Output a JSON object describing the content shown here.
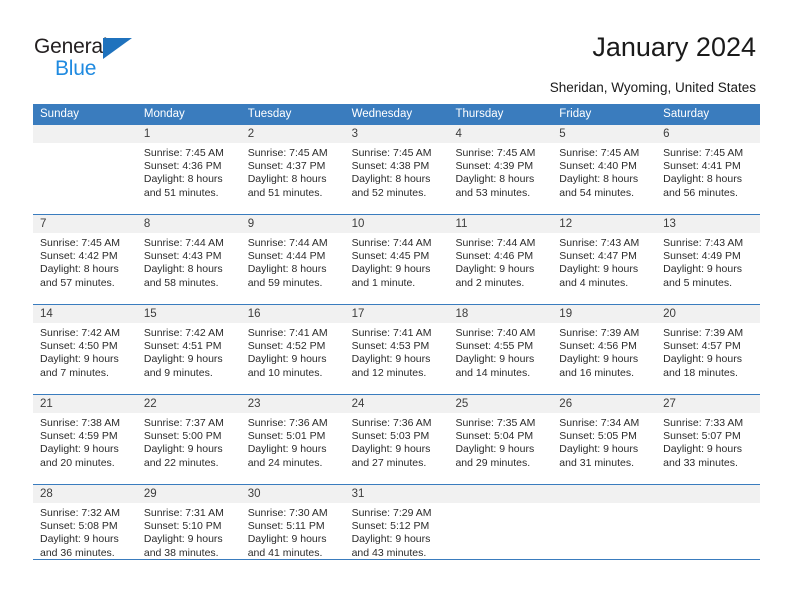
{
  "brand": {
    "name_part1": "General",
    "name_part2": "Blue",
    "triangle_icon": "triangle-icon",
    "color_dark": "#231f20",
    "color_blue": "#1f8ae0",
    "color_triangle": "#1f72bd"
  },
  "header": {
    "title": "January 2024",
    "subtitle": "Sheridan, Wyoming, United States"
  },
  "theme": {
    "header_blue": "#3a7cbe",
    "daynum_band": "#f1f1f1",
    "text": "#2b2b2b"
  },
  "weekday_headers": [
    "Sunday",
    "Monday",
    "Tuesday",
    "Wednesday",
    "Thursday",
    "Friday",
    "Saturday"
  ],
  "weeks": [
    [
      {
        "day": "",
        "lines": [
          "",
          "",
          "",
          ""
        ]
      },
      {
        "day": "1",
        "lines": [
          "Sunrise: 7:45 AM",
          "Sunset: 4:36 PM",
          "Daylight: 8 hours",
          "and 51 minutes."
        ]
      },
      {
        "day": "2",
        "lines": [
          "Sunrise: 7:45 AM",
          "Sunset: 4:37 PM",
          "Daylight: 8 hours",
          "and 51 minutes."
        ]
      },
      {
        "day": "3",
        "lines": [
          "Sunrise: 7:45 AM",
          "Sunset: 4:38 PM",
          "Daylight: 8 hours",
          "and 52 minutes."
        ]
      },
      {
        "day": "4",
        "lines": [
          "Sunrise: 7:45 AM",
          "Sunset: 4:39 PM",
          "Daylight: 8 hours",
          "and 53 minutes."
        ]
      },
      {
        "day": "5",
        "lines": [
          "Sunrise: 7:45 AM",
          "Sunset: 4:40 PM",
          "Daylight: 8 hours",
          "and 54 minutes."
        ]
      },
      {
        "day": "6",
        "lines": [
          "Sunrise: 7:45 AM",
          "Sunset: 4:41 PM",
          "Daylight: 8 hours",
          "and 56 minutes."
        ]
      }
    ],
    [
      {
        "day": "7",
        "lines": [
          "Sunrise: 7:45 AM",
          "Sunset: 4:42 PM",
          "Daylight: 8 hours",
          "and 57 minutes."
        ]
      },
      {
        "day": "8",
        "lines": [
          "Sunrise: 7:44 AM",
          "Sunset: 4:43 PM",
          "Daylight: 8 hours",
          "and 58 minutes."
        ]
      },
      {
        "day": "9",
        "lines": [
          "Sunrise: 7:44 AM",
          "Sunset: 4:44 PM",
          "Daylight: 8 hours",
          "and 59 minutes."
        ]
      },
      {
        "day": "10",
        "lines": [
          "Sunrise: 7:44 AM",
          "Sunset: 4:45 PM",
          "Daylight: 9 hours",
          "and 1 minute."
        ]
      },
      {
        "day": "11",
        "lines": [
          "Sunrise: 7:44 AM",
          "Sunset: 4:46 PM",
          "Daylight: 9 hours",
          "and 2 minutes."
        ]
      },
      {
        "day": "12",
        "lines": [
          "Sunrise: 7:43 AM",
          "Sunset: 4:47 PM",
          "Daylight: 9 hours",
          "and 4 minutes."
        ]
      },
      {
        "day": "13",
        "lines": [
          "Sunrise: 7:43 AM",
          "Sunset: 4:49 PM",
          "Daylight: 9 hours",
          "and 5 minutes."
        ]
      }
    ],
    [
      {
        "day": "14",
        "lines": [
          "Sunrise: 7:42 AM",
          "Sunset: 4:50 PM",
          "Daylight: 9 hours",
          "and 7 minutes."
        ]
      },
      {
        "day": "15",
        "lines": [
          "Sunrise: 7:42 AM",
          "Sunset: 4:51 PM",
          "Daylight: 9 hours",
          "and 9 minutes."
        ]
      },
      {
        "day": "16",
        "lines": [
          "Sunrise: 7:41 AM",
          "Sunset: 4:52 PM",
          "Daylight: 9 hours",
          "and 10 minutes."
        ]
      },
      {
        "day": "17",
        "lines": [
          "Sunrise: 7:41 AM",
          "Sunset: 4:53 PM",
          "Daylight: 9 hours",
          "and 12 minutes."
        ]
      },
      {
        "day": "18",
        "lines": [
          "Sunrise: 7:40 AM",
          "Sunset: 4:55 PM",
          "Daylight: 9 hours",
          "and 14 minutes."
        ]
      },
      {
        "day": "19",
        "lines": [
          "Sunrise: 7:39 AM",
          "Sunset: 4:56 PM",
          "Daylight: 9 hours",
          "and 16 minutes."
        ]
      },
      {
        "day": "20",
        "lines": [
          "Sunrise: 7:39 AM",
          "Sunset: 4:57 PM",
          "Daylight: 9 hours",
          "and 18 minutes."
        ]
      }
    ],
    [
      {
        "day": "21",
        "lines": [
          "Sunrise: 7:38 AM",
          "Sunset: 4:59 PM",
          "Daylight: 9 hours",
          "and 20 minutes."
        ]
      },
      {
        "day": "22",
        "lines": [
          "Sunrise: 7:37 AM",
          "Sunset: 5:00 PM",
          "Daylight: 9 hours",
          "and 22 minutes."
        ]
      },
      {
        "day": "23",
        "lines": [
          "Sunrise: 7:36 AM",
          "Sunset: 5:01 PM",
          "Daylight: 9 hours",
          "and 24 minutes."
        ]
      },
      {
        "day": "24",
        "lines": [
          "Sunrise: 7:36 AM",
          "Sunset: 5:03 PM",
          "Daylight: 9 hours",
          "and 27 minutes."
        ]
      },
      {
        "day": "25",
        "lines": [
          "Sunrise: 7:35 AM",
          "Sunset: 5:04 PM",
          "Daylight: 9 hours",
          "and 29 minutes."
        ]
      },
      {
        "day": "26",
        "lines": [
          "Sunrise: 7:34 AM",
          "Sunset: 5:05 PM",
          "Daylight: 9 hours",
          "and 31 minutes."
        ]
      },
      {
        "day": "27",
        "lines": [
          "Sunrise: 7:33 AM",
          "Sunset: 5:07 PM",
          "Daylight: 9 hours",
          "and 33 minutes."
        ]
      }
    ],
    [
      {
        "day": "28",
        "lines": [
          "Sunrise: 7:32 AM",
          "Sunset: 5:08 PM",
          "Daylight: 9 hours",
          "and 36 minutes."
        ]
      },
      {
        "day": "29",
        "lines": [
          "Sunrise: 7:31 AM",
          "Sunset: 5:10 PM",
          "Daylight: 9 hours",
          "and 38 minutes."
        ]
      },
      {
        "day": "30",
        "lines": [
          "Sunrise: 7:30 AM",
          "Sunset: 5:11 PM",
          "Daylight: 9 hours",
          "and 41 minutes."
        ]
      },
      {
        "day": "31",
        "lines": [
          "Sunrise: 7:29 AM",
          "Sunset: 5:12 PM",
          "Daylight: 9 hours",
          "and 43 minutes."
        ]
      },
      {
        "day": "",
        "lines": [
          "",
          "",
          "",
          ""
        ]
      },
      {
        "day": "",
        "lines": [
          "",
          "",
          "",
          ""
        ]
      },
      {
        "day": "",
        "lines": [
          "",
          "",
          "",
          ""
        ]
      }
    ]
  ]
}
